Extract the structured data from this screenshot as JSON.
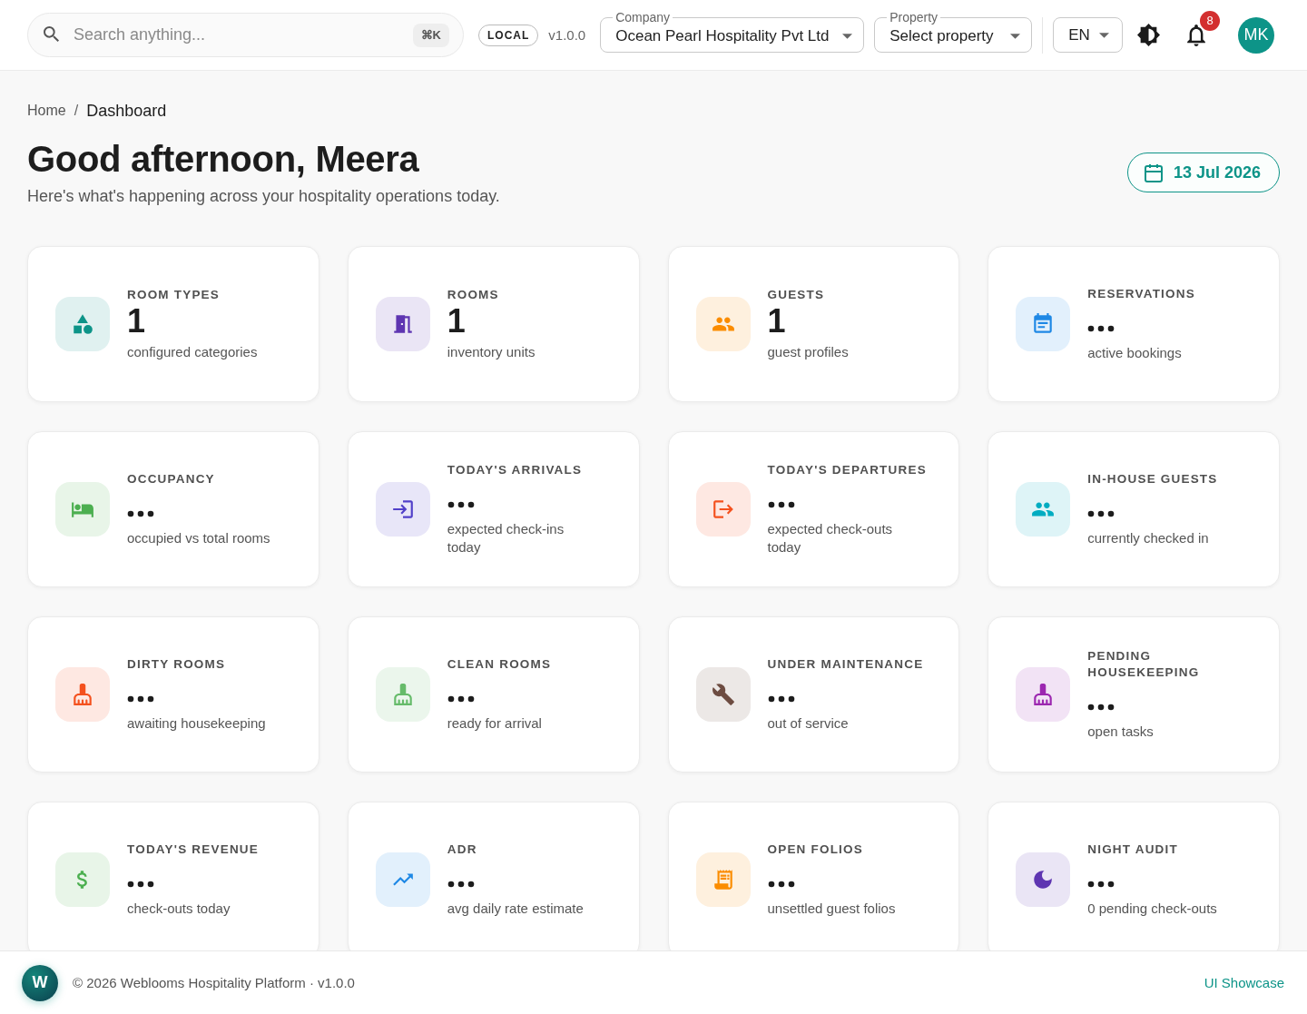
{
  "topbar": {
    "search": {
      "placeholder": "Search anything...",
      "shortcut": "⌘K"
    },
    "environment_badge": "LOCAL",
    "version": "v1.0.0",
    "company_select": {
      "label": "Company",
      "value": "Ocean Pearl Hospitality Pvt Ltd"
    },
    "property_select": {
      "label": "Property",
      "value": "Select property"
    },
    "language_select": {
      "value": "EN"
    },
    "notifications": {
      "count": "8"
    },
    "avatar": {
      "initials": "MK"
    }
  },
  "breadcrumb": {
    "items": [
      {
        "label": "Home",
        "current": false
      },
      {
        "label": "Dashboard",
        "current": true
      }
    ],
    "separator": "/"
  },
  "header": {
    "title": "Good afternoon, Meera",
    "subtitle": "Here's what's happening across your hospitality operations today.",
    "date": "13 Jul 2026"
  },
  "cards": [
    {
      "label": "ROOM TYPES",
      "loading": false,
      "value": "1",
      "description": "configured categories",
      "color": "#0d9488"
    },
    {
      "label": "ROOMS",
      "loading": false,
      "value": "1",
      "description": "inventory units",
      "color": "#5e35b1"
    },
    {
      "label": "GUESTS",
      "loading": false,
      "value": "1",
      "description": "guest profiles",
      "color": "#fb8c00"
    },
    {
      "label": "RESERVATIONS",
      "loading": true,
      "description": "active bookings",
      "color": "#1e88e5"
    },
    {
      "label": "OCCUPANCY",
      "loading": true,
      "description": "occupied vs total rooms",
      "color": "#4caf50"
    },
    {
      "label": "TODAY'S ARRIVALS",
      "loading": true,
      "description": "expected check-ins today",
      "color": "#5140c9"
    },
    {
      "label": "TODAY'S DEPARTURES",
      "loading": true,
      "description": "expected check-outs today",
      "color": "#f4511e"
    },
    {
      "label": "IN-HOUSE GUESTS",
      "loading": true,
      "description": "currently checked in",
      "color": "#00acc1"
    },
    {
      "label": "DIRTY ROOMS",
      "loading": true,
      "description": "awaiting housekeeping",
      "color": "#f4511e"
    },
    {
      "label": "CLEAN ROOMS",
      "loading": true,
      "description": "ready for arrival",
      "color": "#66bb6a"
    },
    {
      "label": "UNDER MAINTENANCE",
      "loading": true,
      "description": "out of service",
      "color": "#6d4c41"
    },
    {
      "label": "PENDING HOUSEKEEPING",
      "loading": true,
      "description": "open tasks",
      "color": "#9c27b0"
    },
    {
      "label": "TODAY'S REVENUE",
      "loading": true,
      "description": "check-outs today",
      "color": "#4caf50"
    },
    {
      "label": "ADR",
      "loading": true,
      "description": "avg daily rate estimate",
      "color": "#1e88e5"
    },
    {
      "label": "OPEN FOLIOS",
      "loading": true,
      "description": "unsettled guest folios",
      "color": "#fb8c00"
    },
    {
      "label": "NIGHT AUDIT",
      "loading": true,
      "description": "0 pending check-outs",
      "color": "#5e35b1"
    }
  ],
  "footer": {
    "logo": "W",
    "copyright": "© 2026 Weblooms Hospitality Platform · v1.0.0",
    "link": "UI Showcase"
  }
}
